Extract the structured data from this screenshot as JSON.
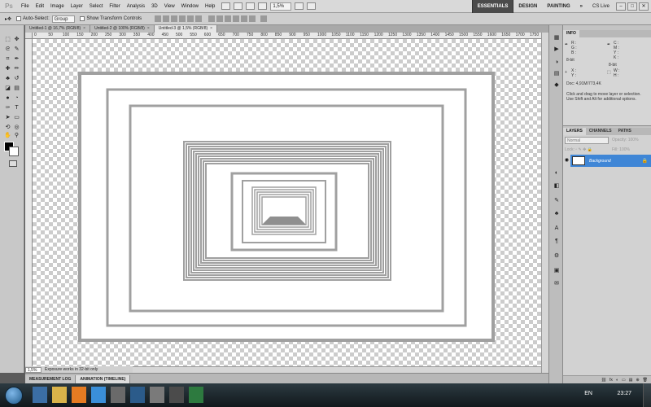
{
  "menubar": {
    "logo": "Ps",
    "items": [
      "File",
      "Edit",
      "Image",
      "Layer",
      "Select",
      "Filter",
      "Analysis",
      "3D",
      "View",
      "Window",
      "Help"
    ],
    "zoom": "1,5%",
    "workspaces": [
      "ESSENTIALS",
      "DESIGN",
      "PAINTING"
    ],
    "more": "»",
    "cs_live": "CS Live",
    "window_controls": [
      "–",
      "□",
      "✕"
    ]
  },
  "optionsbar": {
    "auto_select_label": "Auto-Select:",
    "auto_select_value": "Group",
    "transform_label": "Show Transform Controls"
  },
  "doc_tabs": [
    {
      "label": "Untitled-1 @ 16,7% (RGB/8)"
    },
    {
      "label": "Untitled-2 @ 100% (RGB/8)"
    },
    {
      "label": "Untitled-3 @ 1,5% (RGB/8)"
    }
  ],
  "doc_tab_close": "×",
  "ruler_top_labels": [
    "0",
    "50",
    "100",
    "150",
    "200",
    "250",
    "300",
    "350",
    "400",
    "450",
    "500",
    "550",
    "600",
    "650",
    "700",
    "750",
    "800",
    "850",
    "900",
    "950",
    "1000",
    "1050",
    "1100",
    "1150",
    "1200",
    "1250",
    "1300",
    "1350",
    "1400",
    "1450",
    "1500",
    "1550",
    "1600",
    "1650",
    "1700",
    "1750"
  ],
  "status": {
    "zoom": "1,5%",
    "message": "Exposure works in 32-bit only"
  },
  "bottom_tabs": [
    "MEASUREMENT LOG",
    "ANIMATION (TIMELINE)"
  ],
  "info_panel": {
    "tab": "INFO",
    "r_label": "R :",
    "g_label": "G :",
    "b_label": "B :",
    "c_label": "C :",
    "m_label": "M :",
    "y_label": "Y :",
    "k_label": "K :",
    "bit_left": "8-bit",
    "bit_right": "8-bit",
    "x_label": "X :",
    "y2_label": "Y :",
    "w_label": "W :",
    "h_label": "H :",
    "doc": "Doc: 4,91M/773,4K",
    "hint": "Click and drag to move layer or selection. Use Shift and Alt for additional options."
  },
  "layers_panel": {
    "tabs": [
      "LAYERS",
      "CHANNELS",
      "PATHS"
    ],
    "blend_mode": "Normal",
    "opacity_label": "Opacity:",
    "opacity_value": "100%",
    "lock_label": "Lock:",
    "fill_label": "Fill:",
    "fill_value": "100%",
    "layer_name": "Background",
    "footer_icons": [
      "fx",
      "◐",
      "▭",
      "▤",
      "⊕",
      "🗑"
    ]
  },
  "taskbar": {
    "lang": "EN",
    "clock": "23:27"
  },
  "colors": {
    "ui_gray": "#c8c8c8",
    "selection_blue": "#3f86d6",
    "artwork_stroke": "#a0a0a0"
  }
}
